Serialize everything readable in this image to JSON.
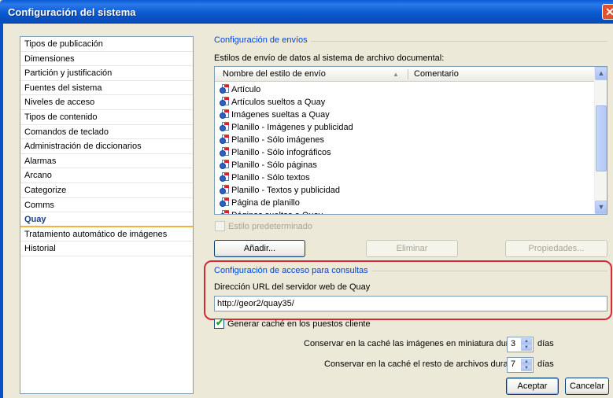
{
  "window": {
    "title": "Configuración del sistema",
    "close_symbol": "✕"
  },
  "sidebar": {
    "items": [
      "Tipos de publicación",
      "Dimensiones",
      "Partición y justificación",
      "Fuentes del sistema",
      "Niveles de acceso",
      "Tipos de contenido",
      "Comandos de teclado",
      "Administración de diccionarios",
      "Alarmas",
      "Arcano",
      "Categorize",
      "Comms",
      "Quay",
      "Tratamiento automático de imágenes",
      "Historial"
    ],
    "selected": "Quay"
  },
  "envios": {
    "group_title": "Configuración de envíos",
    "description": "Estilos de envío de datos al sistema de archivo documental:",
    "columns": {
      "name": "Nombre del estilo de envío",
      "sort_arrow": "▲",
      "comment": "Comentario"
    },
    "rows": [
      "Artículo",
      "Artículos sueltos a Quay",
      "Imágenes sueltas a Quay",
      "Planillo - Imágenes y publicidad",
      "Planillo - Sólo imágenes",
      "Planillo - Sólo infográficos",
      "Planillo - Sólo páginas",
      "Planillo - Sólo textos",
      "Planillo - Textos y publicidad",
      "Página de planillo",
      "Páginas sueltas a Quay"
    ],
    "scroll_up": "▲",
    "scroll_down": "▼",
    "default_style_label": "Estilo predeterminado",
    "default_style_checked": false,
    "add_button": "Añadir...",
    "delete_button": "Eliminar",
    "properties_button": "Propiedades..."
  },
  "consultas": {
    "group_title": "Configuración de acceso para consultas",
    "url_label": "Dirección URL del servidor web de Quay",
    "url_value": "http://geor2/quay35/"
  },
  "cache": {
    "generate_label": "Generar caché en los puestos cliente",
    "generate_checked": true,
    "check_mark": "✔",
    "thumbnails_label": "Conservar en la caché las imágenes en miniatura durante:",
    "thumbnails_days": "3",
    "other_label": "Conservar en la caché el resto de archivos durante:",
    "other_days": "7",
    "days_unit": "días",
    "spin_up": "▲",
    "spin_down": "▼"
  },
  "footer": {
    "accept": "Aceptar",
    "cancel": "Cancelar"
  }
}
